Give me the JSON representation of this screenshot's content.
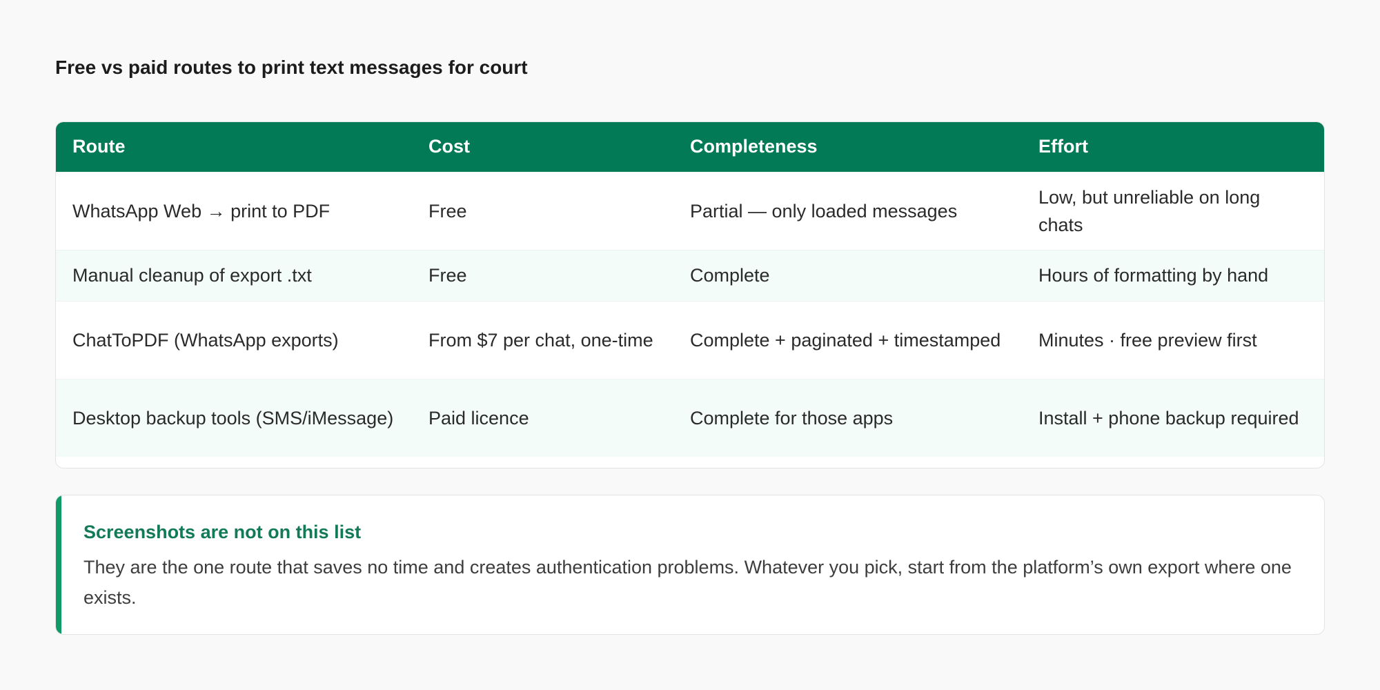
{
  "page": {
    "title": "Free vs paid routes to print text messages for court"
  },
  "table": {
    "headers": [
      "Route",
      "Cost",
      "Completeness",
      "Effort"
    ],
    "rows": [
      [
        "WhatsApp Web → print to PDF",
        "Free",
        "Partial — only loaded messages",
        "Low, but unreliable on long chats"
      ],
      [
        "Manual cleanup of export .txt",
        "Free",
        "Complete",
        "Hours of formatting by hand"
      ],
      [
        "ChatToPDF (WhatsApp exports)",
        "From $7 per chat, one-time",
        "Complete + paginated + timestamped",
        "Minutes · free preview first"
      ],
      [
        "Desktop backup tools (SMS/iMessage)",
        "Paid licence",
        "Complete for those apps",
        "Install + phone backup required"
      ]
    ]
  },
  "note": {
    "title": "Screenshots are not on this list",
    "body": "They are the one route that saves no time and creates authentication problems. Whatever you pick, start from the platform’s own export where one exists."
  },
  "colors": {
    "header_bg": "#027a55",
    "accent": "#0f9a68",
    "note_title": "#127a56",
    "alt_row": "#f3fcf8"
  }
}
